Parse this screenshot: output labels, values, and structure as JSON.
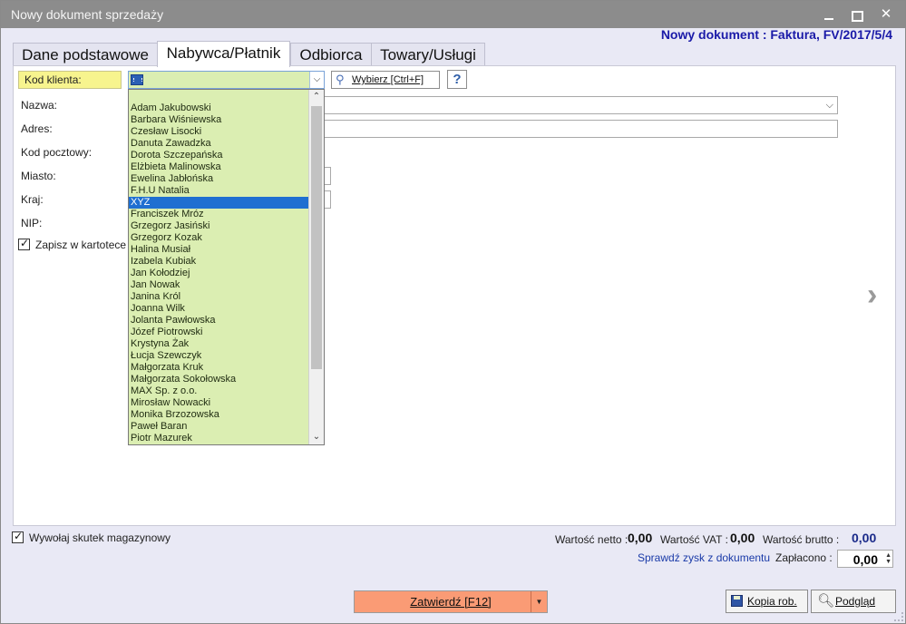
{
  "window": {
    "title": "Nowy dokument sprzedaży",
    "document_header": "Nowy dokument : Faktura, FV/2017/5/4",
    "minimize": "",
    "maximize": "",
    "close": "✕"
  },
  "tabs": [
    {
      "label": "Dane podstawowe",
      "active": false
    },
    {
      "label": "Nabywca/Płatnik",
      "active": true
    },
    {
      "label": "Odbiorca",
      "active": false
    },
    {
      "label": "Towary/Usługi",
      "active": false
    }
  ],
  "form": {
    "kod_klienta_label": "Kod klienta:",
    "wybierz_label": "Wybierz [Ctrl+F]",
    "help_label": "?",
    "nazwa_label": "Nazwa:",
    "adres_label": "Adres:",
    "kod_pocztowy_label": "Kod pocztowy:",
    "miasto_label": "Miasto:",
    "kraj_label": "Kraj:",
    "nip_label": "NIP:",
    "zapisz_label": "Zapisz w kartotece kli",
    "zapisz_checked": true
  },
  "client_list": {
    "items": [
      "Adam Jakubowski",
      "Barbara Wiśniewska",
      "Czesław Lisocki",
      "Danuta Zawadzka",
      "Dorota Szczepańska",
      "Elżbieta Malinowska",
      "Ewelina Jabłońska",
      "F.H.U Natalia",
      "XYZ",
      "Franciszek Mróz",
      "Grzegorz Jasiński",
      "Grzegorz Kozak",
      "Halina Musiał",
      "Izabela Kubiak",
      "Jan Kołodziej",
      "Jan Nowak",
      "Janina Król",
      "Joanna Wilk",
      "Jolanta Pawłowska",
      "Józef Piotrowski",
      "Krystyna Żak",
      "Łucja Szewczyk",
      "Małgorzata Kruk",
      "Małgorzata Sokołowska",
      "MAX Sp. z o.o.",
      "Mirosław Nowacki",
      "Monika Brzozowska",
      "Paweł Baran",
      "Piotr Mazurek"
    ],
    "selected": "XYZ"
  },
  "footer": {
    "wywolaj_label": "Wywołaj skutek magazynowy",
    "wywolaj_checked": true,
    "netto_label": "Wartość netto :",
    "netto_value": "0,00",
    "vat_label": "Wartość VAT :",
    "vat_value": "0,00",
    "brutto_label": "Wartość brutto :",
    "brutto_value": "0,00",
    "sprawdz_link": "Sprawdź zysk z dokumentu",
    "zaplacono_label": "Zapłacono :",
    "zaplacono_value": "0,00",
    "zatwierdz_label": "Zatwierdź [F12]",
    "kopia_label": "Kopia rob.",
    "podglad_label": "Podgląd"
  },
  "colors": {
    "kod_label_bg": "#f7f48e",
    "list_bg": "#dbeeb2",
    "selection": "#1f6fd1",
    "zatwierdz_bg": "#fa9b75",
    "header_text": "#1a1aa8"
  }
}
